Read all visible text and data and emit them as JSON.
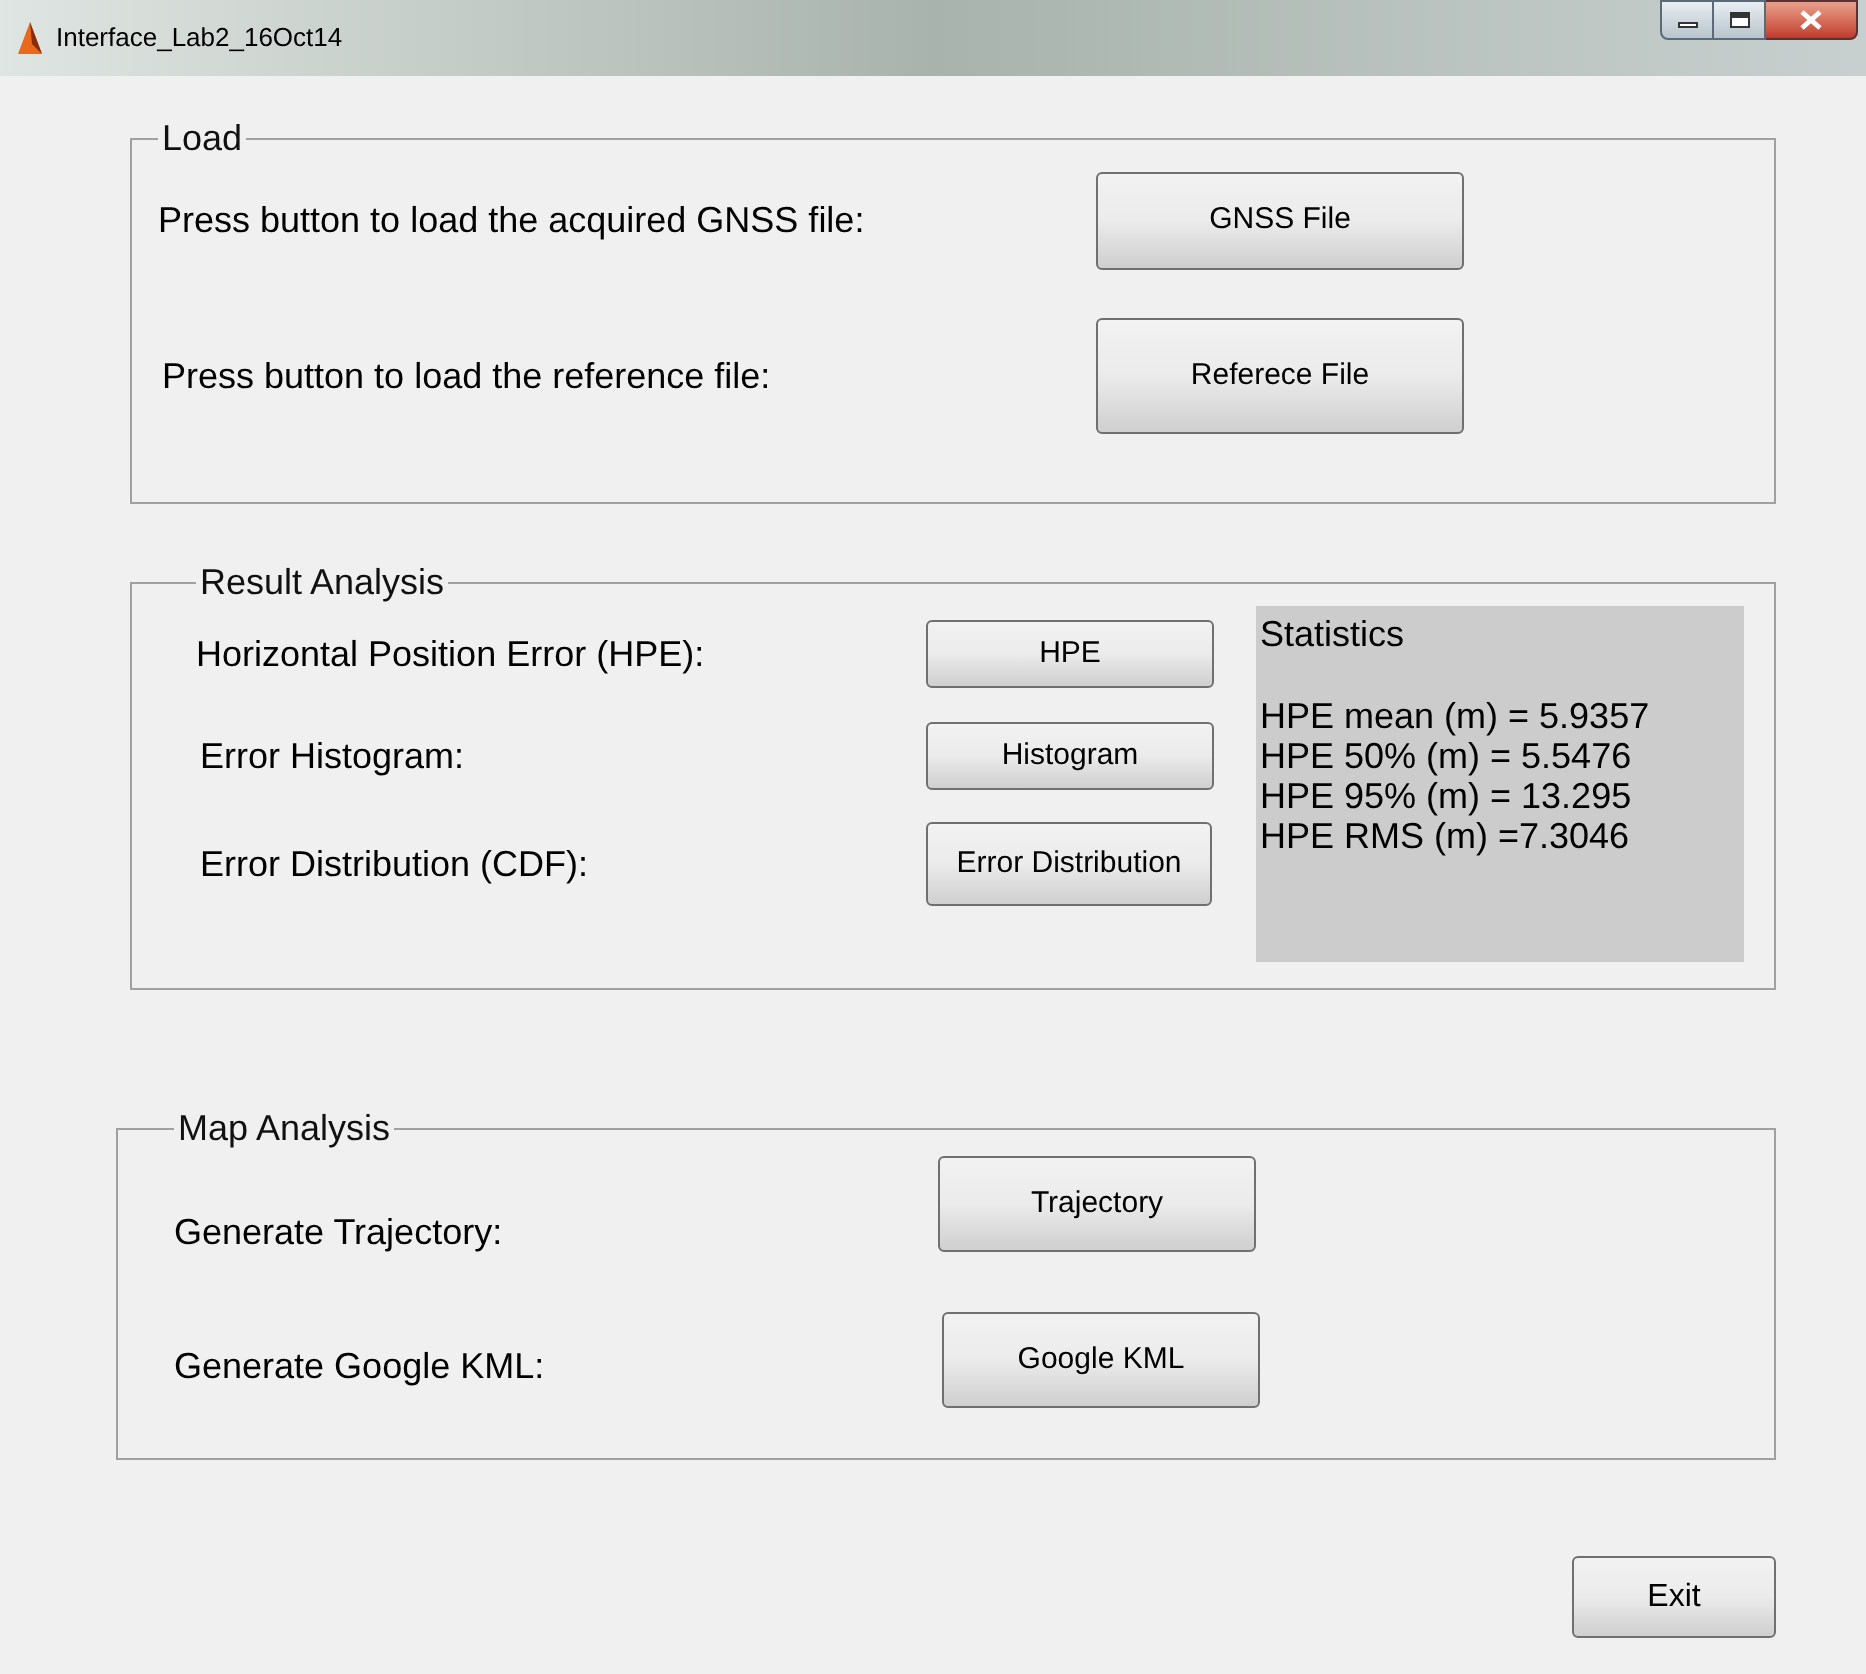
{
  "window": {
    "title": "Interface_Lab2_16Oct14"
  },
  "load": {
    "title": "Load",
    "rows": [
      {
        "label": "Press button to load the acquired GNSS file:",
        "button": "GNSS File"
      },
      {
        "label": "Press button to load the reference file:",
        "button": "Referece File"
      }
    ]
  },
  "result_analysis": {
    "title": "Result Analysis",
    "rows": [
      {
        "label": "Horizontal Position Error (HPE):",
        "button": "HPE"
      },
      {
        "label": "Error Histogram:",
        "button": "Histogram"
      },
      {
        "label": "Error Distribution (CDF):",
        "button": "Error Distribution"
      }
    ],
    "statistics": {
      "title": "Statistics",
      "lines": [
        "HPE mean (m) = 5.9357",
        "HPE 50% (m) = 5.5476",
        "HPE 95% (m) = 13.295",
        "HPE RMS (m) =7.3046"
      ]
    }
  },
  "map_analysis": {
    "title": "Map Analysis",
    "rows": [
      {
        "label": "Generate Trajectory:",
        "button": "Trajectory"
      },
      {
        "label": "Generate Google KML:",
        "button": "Google KML"
      }
    ]
  },
  "exit_button": "Exit"
}
